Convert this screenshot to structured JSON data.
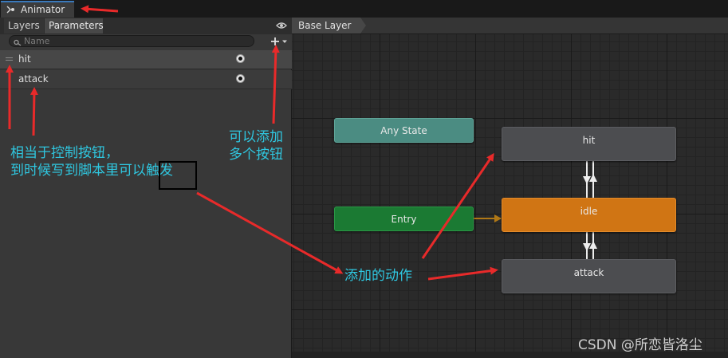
{
  "window": {
    "tab_label": "Animator",
    "tab_icon": "animator-icon"
  },
  "left_panel": {
    "tabs": [
      "Layers",
      "Parameters"
    ],
    "active_tab": "Parameters",
    "search": {
      "value": "",
      "placeholder": "Name"
    },
    "add_button_icon": "plus-dropdown-icon",
    "visibility_icon": "eye-icon",
    "parameters": [
      {
        "name": "hit",
        "type": "trigger"
      },
      {
        "name": "attack",
        "type": "trigger"
      }
    ]
  },
  "graph": {
    "breadcrumb": "Base Layer",
    "states": {
      "any_state": "Any State",
      "entry": "Entry",
      "hit": "hit",
      "idle": "idle",
      "attack": "attack"
    }
  },
  "annotations": {
    "control_buttons": [
      "相当于控制按钮，",
      "到时候写到脚本里可以触发"
    ],
    "add_buttons": [
      "可以添加",
      "多个按钮"
    ],
    "added_actions": "添加的动作",
    "arrow_color": "#e82a2a",
    "text_color": "#2fc7e0"
  },
  "watermark": "CSDN @所恋皆洛尘"
}
